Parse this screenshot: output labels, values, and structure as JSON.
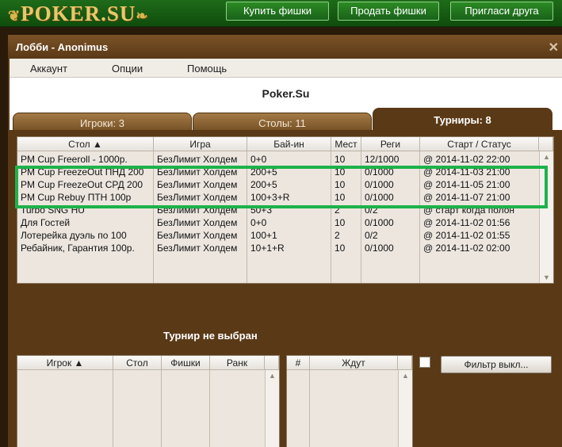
{
  "site": {
    "logo": "POKER.SU",
    "buttons": [
      "Купить фишки",
      "Продать фишки",
      "Пригласи друга"
    ]
  },
  "window": {
    "title": "Лобби - Anonimus",
    "close_icon": "close-icon"
  },
  "menu": [
    "Аккаунт",
    "Опции",
    "Помощь"
  ],
  "brand": "Poker.Su",
  "tabs": [
    {
      "label": "Игроки: 3",
      "active": false
    },
    {
      "label": "Столы: 11",
      "active": false
    },
    {
      "label": "Турниры: 8",
      "active": true
    }
  ],
  "tournaments": {
    "columns": [
      "Стол ▲",
      "Игра",
      "Бай-ин",
      "Мест",
      "Реги",
      "Старт / Статус"
    ],
    "rows": [
      [
        "PM Cup Freeroll - 1000р.",
        "БезЛимит Холдем",
        "0+0",
        "10",
        "12/1000",
        "@ 2014-11-02 22:00"
      ],
      [
        "PM Cup FreezeOut ПНД 200",
        "БезЛимит Холдем",
        "200+5",
        "10",
        "0/1000",
        "@ 2014-11-03 21:00"
      ],
      [
        "PM Cup FreezeOut СРД 200",
        "БезЛимит Холдем",
        "200+5",
        "10",
        "0/1000",
        "@ 2014-11-05 21:00"
      ],
      [
        "PM Cup Rebuy ПТН 100р",
        "БезЛимит Холдем",
        "100+3+R",
        "10",
        "0/1000",
        "@ 2014-11-07 21:00"
      ],
      [
        "Turbo SNG HU",
        "БезЛимит Холдем",
        "50+3",
        "2",
        "0/2",
        "@ старт когда полон"
      ],
      [
        "Для Гостей",
        "БезЛимит Холдем",
        "0+0",
        "10",
        "0/1000",
        "@ 2014-11-02 01:56"
      ],
      [
        "Лотерейка дуэль по 100",
        "БезЛимит Холдем",
        "100+1",
        "2",
        "0/2",
        "@ 2014-11-02 01:55"
      ],
      [
        "Ребайник, Гарантия 100р.",
        "БезЛимит Холдем",
        "10+1+R",
        "10",
        "0/1000",
        "@ 2014-11-02 02:00"
      ]
    ]
  },
  "no_selection": "Турнир не выбран",
  "players": {
    "columns": [
      "Игрок ▲",
      "Стол",
      "Фишки",
      "Ранк"
    ]
  },
  "waiting": {
    "columns": [
      "#",
      "Ждут"
    ]
  },
  "filter_button": "Фильтр выкл...",
  "colors": {
    "highlight": "#1db24a",
    "window_bg": "#5a3917",
    "site_green": "#1f6b1a"
  }
}
